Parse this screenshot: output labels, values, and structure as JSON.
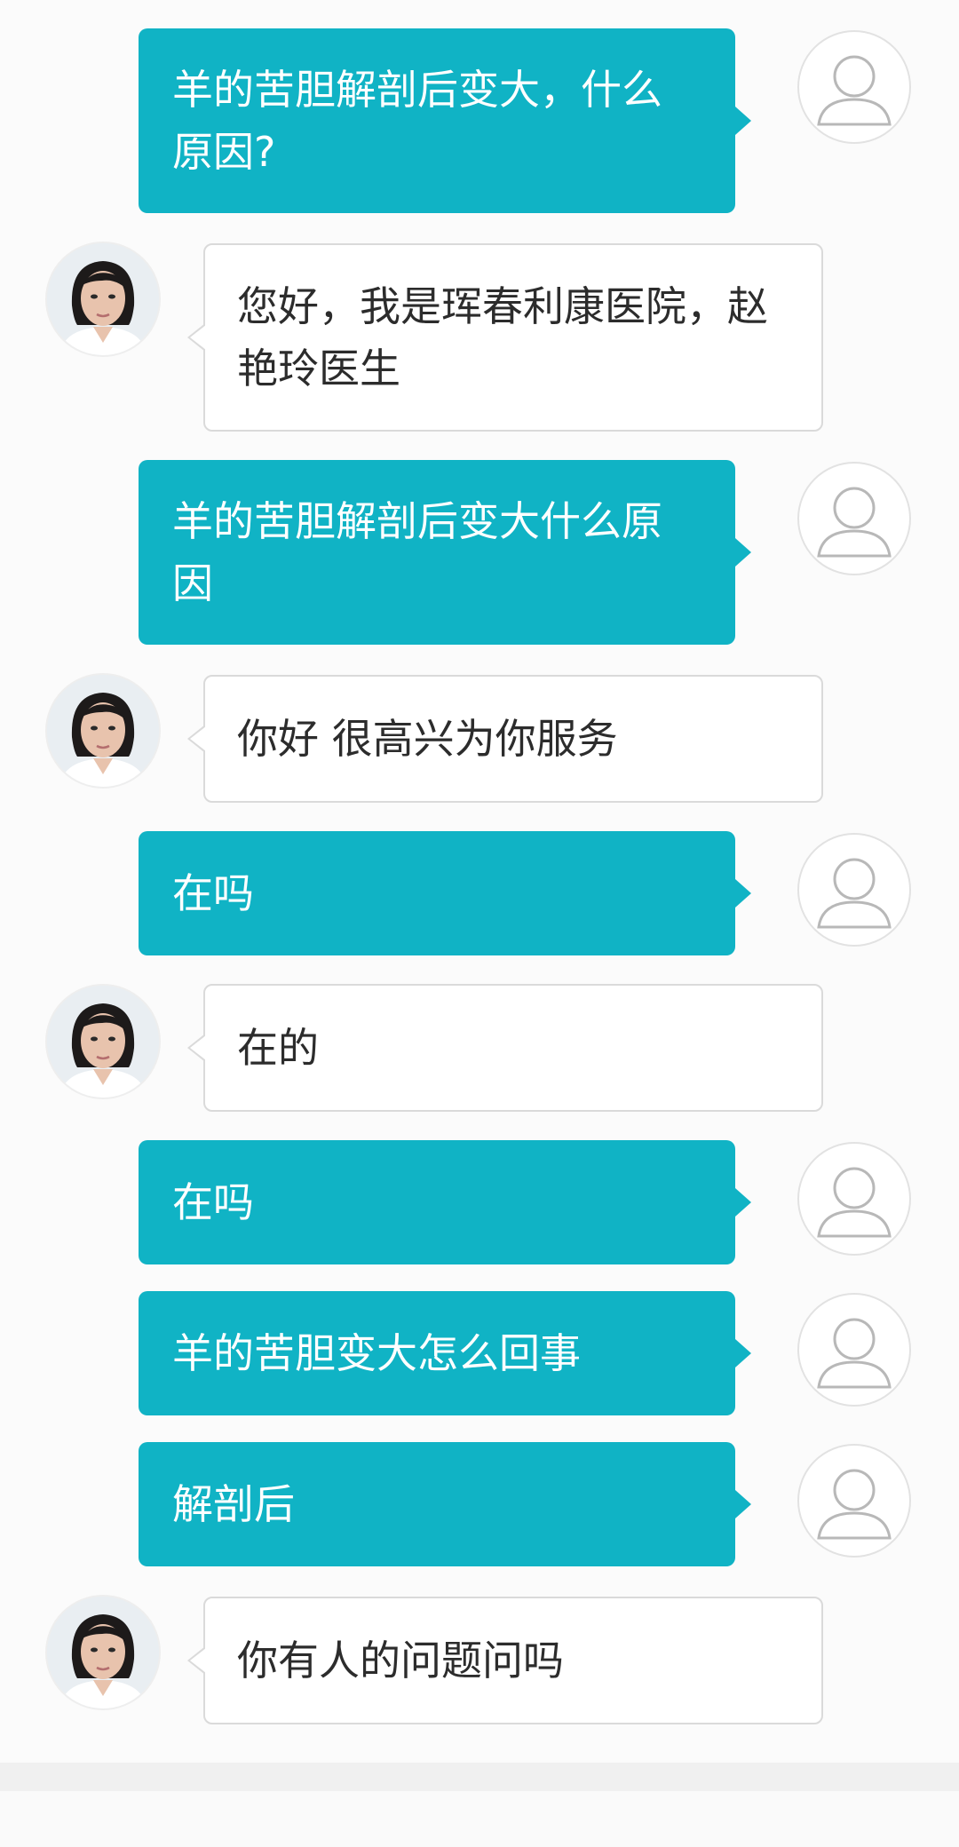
{
  "conversation": {
    "messages": [
      {
        "sender": "user",
        "text": "羊的苦胆解剖后变大，什么原因?"
      },
      {
        "sender": "doctor",
        "text": "您好，我是珲春利康医院，赵艳玲医生"
      },
      {
        "sender": "user",
        "text": "羊的苦胆解剖后变大什么原因"
      },
      {
        "sender": "doctor",
        "text": "你好 很高兴为你服务"
      },
      {
        "sender": "user",
        "text": "在吗"
      },
      {
        "sender": "doctor",
        "text": "在的"
      },
      {
        "sender": "user",
        "text": "在吗"
      },
      {
        "sender": "user",
        "text": "羊的苦胆变大怎么回事"
      },
      {
        "sender": "user",
        "text": "解剖后"
      },
      {
        "sender": "doctor",
        "text": "你有人的问题问吗"
      }
    ]
  },
  "colors": {
    "user_bubble": "#10b3c5",
    "doctor_bubble": "#ffffff",
    "background": "#fbfbfb"
  },
  "icons": {
    "user_avatar": "default-user-icon",
    "doctor_avatar": "doctor-photo"
  }
}
